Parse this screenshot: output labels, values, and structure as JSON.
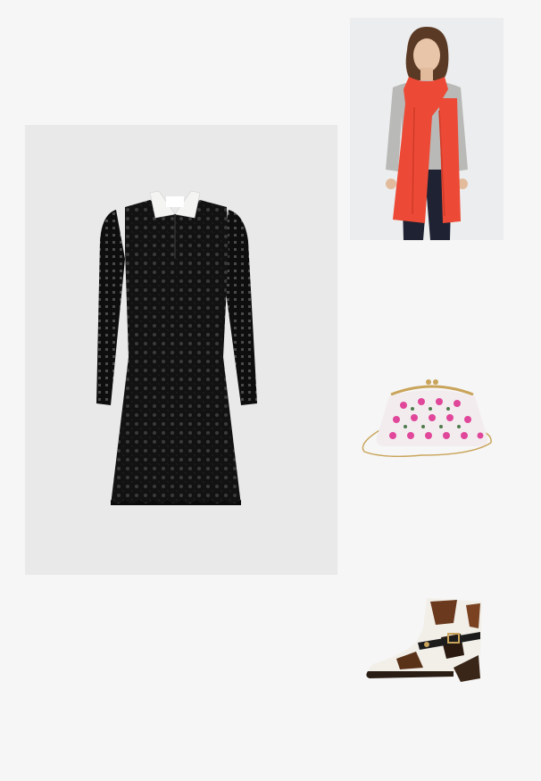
{
  "board": {
    "items": [
      {
        "name": "black-lace-dress-with-white-collar",
        "icon": "dress-image"
      },
      {
        "name": "model-wearing-red-scarf",
        "icon": "scarf-image"
      },
      {
        "name": "floral-frame-clutch-with-gold-chain",
        "icon": "bag-image"
      },
      {
        "name": "cowhide-ankle-boot-with-buckle",
        "icon": "boot-image"
      }
    ]
  },
  "colors": {
    "page_background": "#f6f6f6",
    "dress_panel": "#e9e9e9",
    "scarf_red": "#ec4a36",
    "dress_black": "#151515",
    "bag_pink": "#e0479a",
    "gold": "#c9a45a"
  }
}
